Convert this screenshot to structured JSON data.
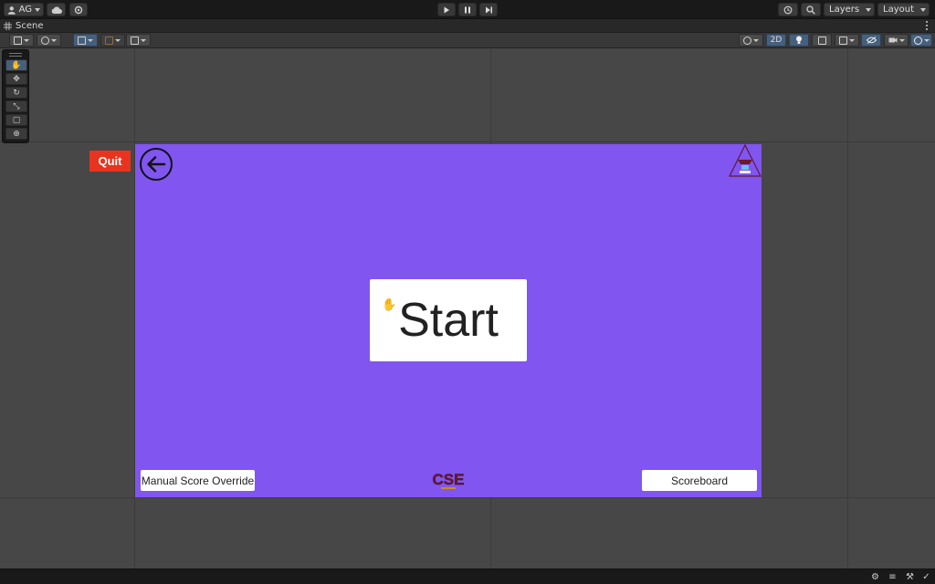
{
  "topbar": {
    "account_label": "AG",
    "layers_label": "Layers",
    "layout_label": "Layout"
  },
  "tab": {
    "scene_label": "Scene"
  },
  "scene_toolbar": {
    "mode_2d_label": "2D"
  },
  "game": {
    "background_color": "#8155f0",
    "quit_label": "Quit",
    "start_label": "Start",
    "manual_score_label": "Manual Score Override",
    "scoreboard_label": "Scoreboard",
    "logo_text": "CSE"
  },
  "colors": {
    "quit_red": "#e8341e",
    "toolbar_active": "#46607c",
    "viewport_bg": "#474747"
  }
}
